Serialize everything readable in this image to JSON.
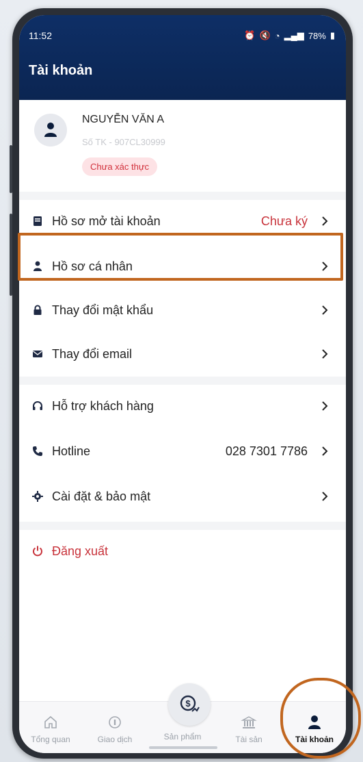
{
  "status": {
    "time": "11:52",
    "battery": "78%"
  },
  "header": {
    "title": "Tài khoản"
  },
  "profile": {
    "name": "NGUYỄN VĂN A",
    "account_label": "Số TK - 907CL30999",
    "badge": "Chưa xác thực"
  },
  "menu_group1": [
    {
      "label": "Hồ sơ mở tài khoản",
      "value": "Chưa ký",
      "icon": "document-icon"
    },
    {
      "label": "Hồ sơ cá nhân",
      "value": "",
      "icon": "user-icon"
    },
    {
      "label": "Thay đổi mật khẩu",
      "value": "",
      "icon": "lock-icon"
    },
    {
      "label": "Thay đổi email",
      "value": "",
      "icon": "mail-icon"
    }
  ],
  "menu_group2": [
    {
      "label": "Hỗ trợ khách hàng",
      "value": "",
      "icon": "headset-icon"
    },
    {
      "label": "Hotline",
      "value": "028 7301 7786",
      "icon": "phone-icon"
    },
    {
      "label": "Cài đặt & bảo mật",
      "value": "",
      "icon": "gear-icon"
    }
  ],
  "logout": {
    "label": "Đăng xuất",
    "icon": "power-icon"
  },
  "bottom_nav": [
    {
      "label": "Tổng quan",
      "icon": "home-icon"
    },
    {
      "label": "Giao dịch",
      "icon": "transaction-icon"
    },
    {
      "label": "Sản phẩm",
      "icon": "product-icon"
    },
    {
      "label": "Tài sản",
      "icon": "bank-icon"
    },
    {
      "label": "Tài khoản",
      "icon": "user-icon",
      "active": true
    }
  ],
  "colors": {
    "header_bg": "#0e2f66",
    "danger": "#c8323a",
    "badge_bg": "#fde2e5",
    "highlight": "#c1661f"
  }
}
